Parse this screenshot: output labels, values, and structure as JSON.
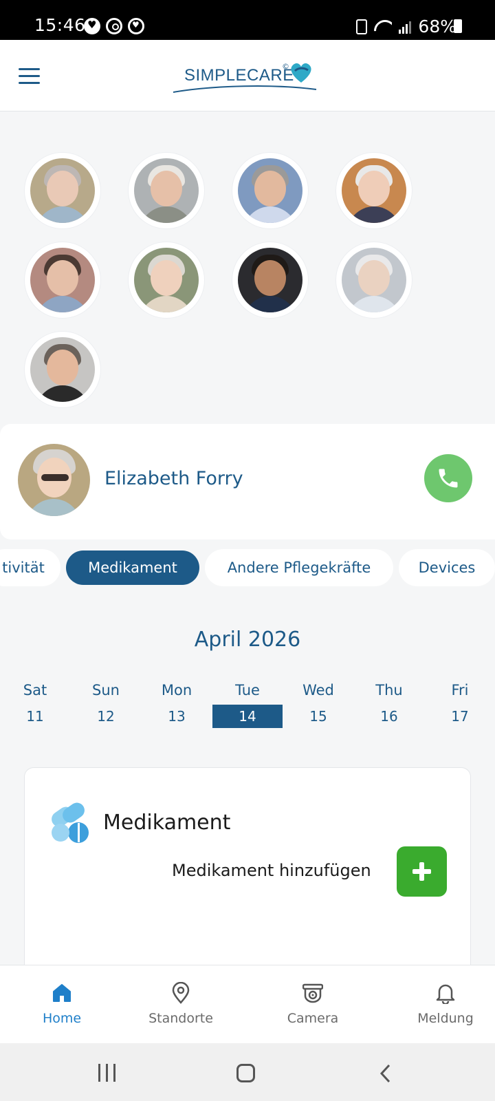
{
  "status_bar": {
    "time": "15:46",
    "battery": "68%",
    "icons": [
      "simplecare-notification-icon",
      "whatsapp-icon",
      "app-notification-icon",
      "lock-icon",
      "wifi-icon",
      "signal-icon",
      "battery-icon"
    ]
  },
  "header": {
    "logo_text": "SIMPLECARE",
    "logo_mark": "©",
    "menu_icon": "hamburger-menu-icon"
  },
  "residents": [
    {
      "face": "#e9c9b6",
      "hair": "#bdb7b4",
      "body": "#9fb6c9",
      "bg": "#b7a98a"
    },
    {
      "face": "#e6c0a8",
      "hair": "#e9e6e1",
      "body": "#8b8f86",
      "bg": "#aeb2b4"
    },
    {
      "face": "#e2b99e",
      "hair": "#9b9a99",
      "body": "#cfd9ec",
      "bg": "#7f9ac0"
    },
    {
      "face": "#efcdb8",
      "hair": "#e8e8e8",
      "body": "#3c3f56",
      "bg": "#c8884f"
    },
    {
      "face": "#e5bfa8",
      "hair": "#4b3a33",
      "body": "#8ea5c3",
      "bg": "#b48a80"
    },
    {
      "face": "#efd1bd",
      "hair": "#dbd8d1",
      "body": "#e2d6c4",
      "bg": "#8a9678"
    },
    {
      "face": "#b88462",
      "hair": "#1f1a17",
      "body": "#21304a",
      "bg": "#2b2b2f"
    },
    {
      "face": "#ead2c1",
      "hair": "#e9e9ea",
      "body": "#dfe5ec",
      "bg": "#c2c7cd"
    },
    {
      "face": "#e4b89c",
      "hair": "#6b625b",
      "body": "#2a2a2a",
      "bg": "#c6c5c3"
    }
  ],
  "patient": {
    "name": "Elizabeth Forry",
    "call_icon": "phone-icon"
  },
  "tabs": [
    {
      "label": "tivität",
      "active": false
    },
    {
      "label": "Medikament",
      "active": true
    },
    {
      "label": "Andere Pflegekräfte",
      "active": false
    },
    {
      "label": "Devices",
      "active": false
    }
  ],
  "calendar": {
    "month": "April 2026",
    "days": [
      {
        "name": "Sat",
        "num": "11"
      },
      {
        "name": "Sun",
        "num": "12"
      },
      {
        "name": "Mon",
        "num": "13"
      },
      {
        "name": "Tue",
        "num": "14",
        "selected": true
      },
      {
        "name": "Wed",
        "num": "15"
      },
      {
        "name": "Thu",
        "num": "16"
      },
      {
        "name": "Fri",
        "num": "17"
      }
    ]
  },
  "medication": {
    "title": "Medikament",
    "add_label": "Medikament hinzufügen",
    "icon": "pills-icon",
    "add_icon": "plus-icon"
  },
  "bottom_nav": [
    {
      "label": "Home",
      "icon": "home-icon",
      "active": true
    },
    {
      "label": "Standorte",
      "icon": "location-pin-icon",
      "active": false
    },
    {
      "label": "Camera",
      "icon": "camera-icon",
      "active": false
    },
    {
      "label": "Meldung",
      "icon": "bell-icon",
      "active": false
    }
  ],
  "colors": {
    "primary": "#1d5a88",
    "call_green": "#6ec76e",
    "add_green": "#3aab2e",
    "nav_active": "#1f7fc9"
  }
}
